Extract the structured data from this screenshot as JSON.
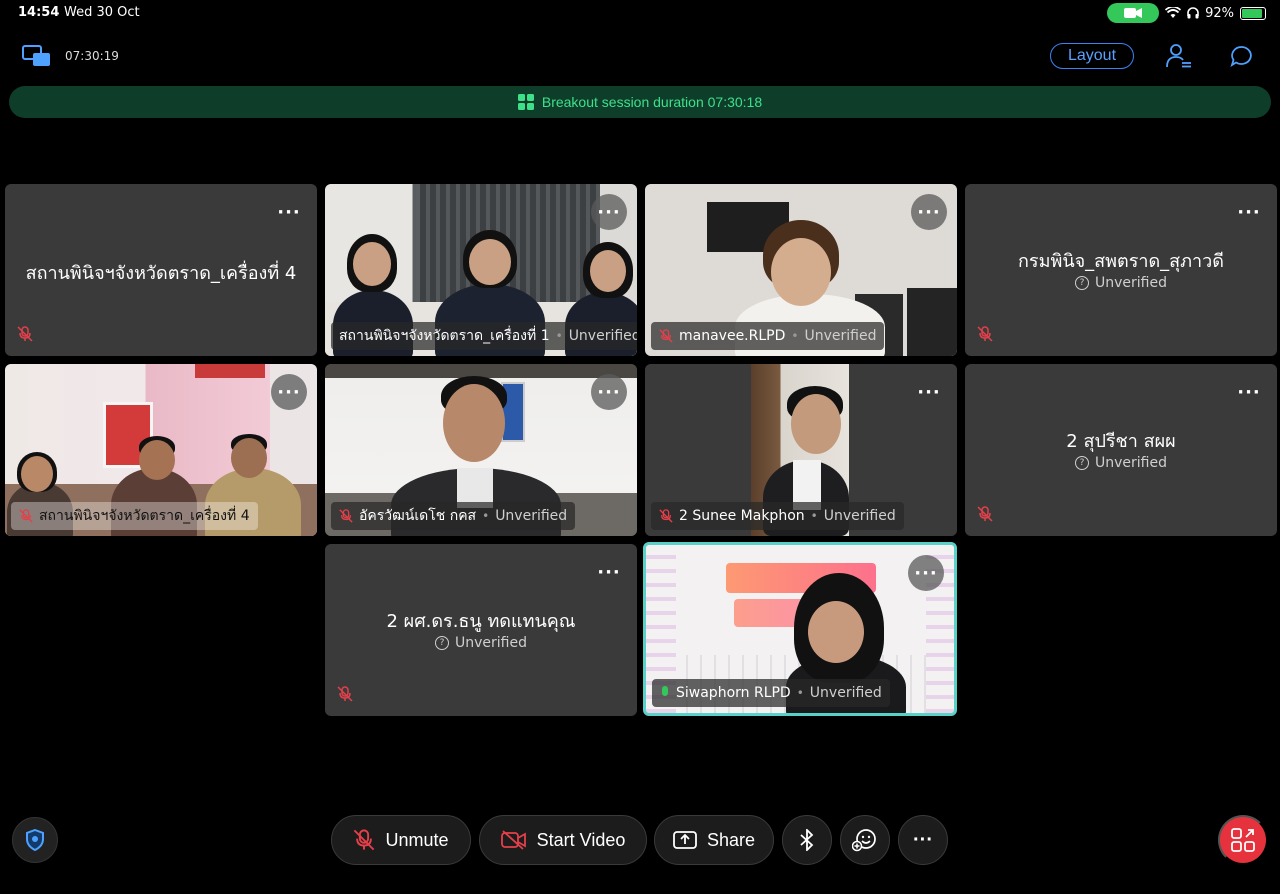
{
  "status_bar": {
    "time": "14:54",
    "date": "Wed 30 Oct",
    "battery": "92%"
  },
  "topbar": {
    "elapsed": "07:30:19",
    "layout_label": "Layout"
  },
  "banner": {
    "text": "Breakout session duration 07:30:18"
  },
  "tiles": [
    {
      "center_name": "สถานพินิจฯจังหวัดตราด_เครื่องที่ 4"
    },
    {
      "name": "สถานพินิจฯจังหวัดตราด_เครื่องที่ 1",
      "status": "Unverified"
    },
    {
      "name": "manavee.RLPD",
      "status": "Unverified"
    },
    {
      "center_name": "กรมพินิจ_สพตราด_สุภาวดี",
      "status": "Unverified"
    },
    {
      "name": "สถานพินิจฯจังหวัดตราด_เครื่องที่ 4"
    },
    {
      "name": "อัครวัฒน์เดโช กคส",
      "status": "Unverified"
    },
    {
      "name": "2 Sunee Makphon",
      "status": "Unverified"
    },
    {
      "center_name": "2 สุปรีชา สผผ",
      "status": "Unverified"
    },
    {
      "center_name": "2 ผศ.ดร.ธนู ทดแทนคุณ",
      "status": "Unverified"
    },
    {
      "name": "Siwaphorn RLPD",
      "status": "Unverified"
    }
  ],
  "toolbar": {
    "unmute": "Unmute",
    "start_video": "Start Video",
    "share": "Share"
  },
  "colors": {
    "accent": "#3b82f6",
    "banner_text": "#3ee08a",
    "active_border": "#5ad1c8",
    "muted": "#e5404a"
  }
}
